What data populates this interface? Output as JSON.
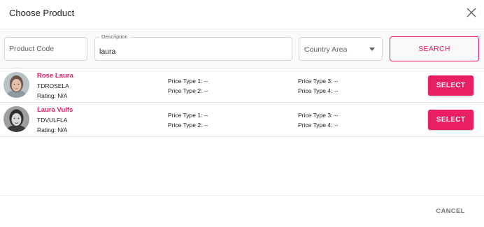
{
  "dialog": {
    "title": "Choose Product",
    "close_icon": "close-icon"
  },
  "search": {
    "product_code_placeholder": "Product Code",
    "description_label": "Description",
    "description_value": "laura",
    "country_area_value": "Country Area",
    "search_label": "SEARCH"
  },
  "results": [
    {
      "name": "Rose Laura",
      "code": "TDROSELA",
      "rating": "Rating: N/A",
      "price_type_1": "Price Type 1: --",
      "price_type_2": "Price Type 2: --",
      "price_type_3": "Price Type 3: --",
      "price_type_4": "Price Type 4: --",
      "select_label": "SELECT"
    },
    {
      "name": "Laura Vulfs",
      "code": "TDVULFLA",
      "rating": "Rating: N/A",
      "price_type_1": "Price Type 1: --",
      "price_type_2": "Price Type 2: --",
      "price_type_3": "Price Type 3: --",
      "price_type_4": "Price Type 4: --",
      "select_label": "SELECT"
    }
  ],
  "footer": {
    "cancel_label": "CANCEL"
  },
  "colors": {
    "accent": "#e91e63",
    "text": "#212121",
    "muted": "#757575",
    "border": "#e0e0e0"
  }
}
